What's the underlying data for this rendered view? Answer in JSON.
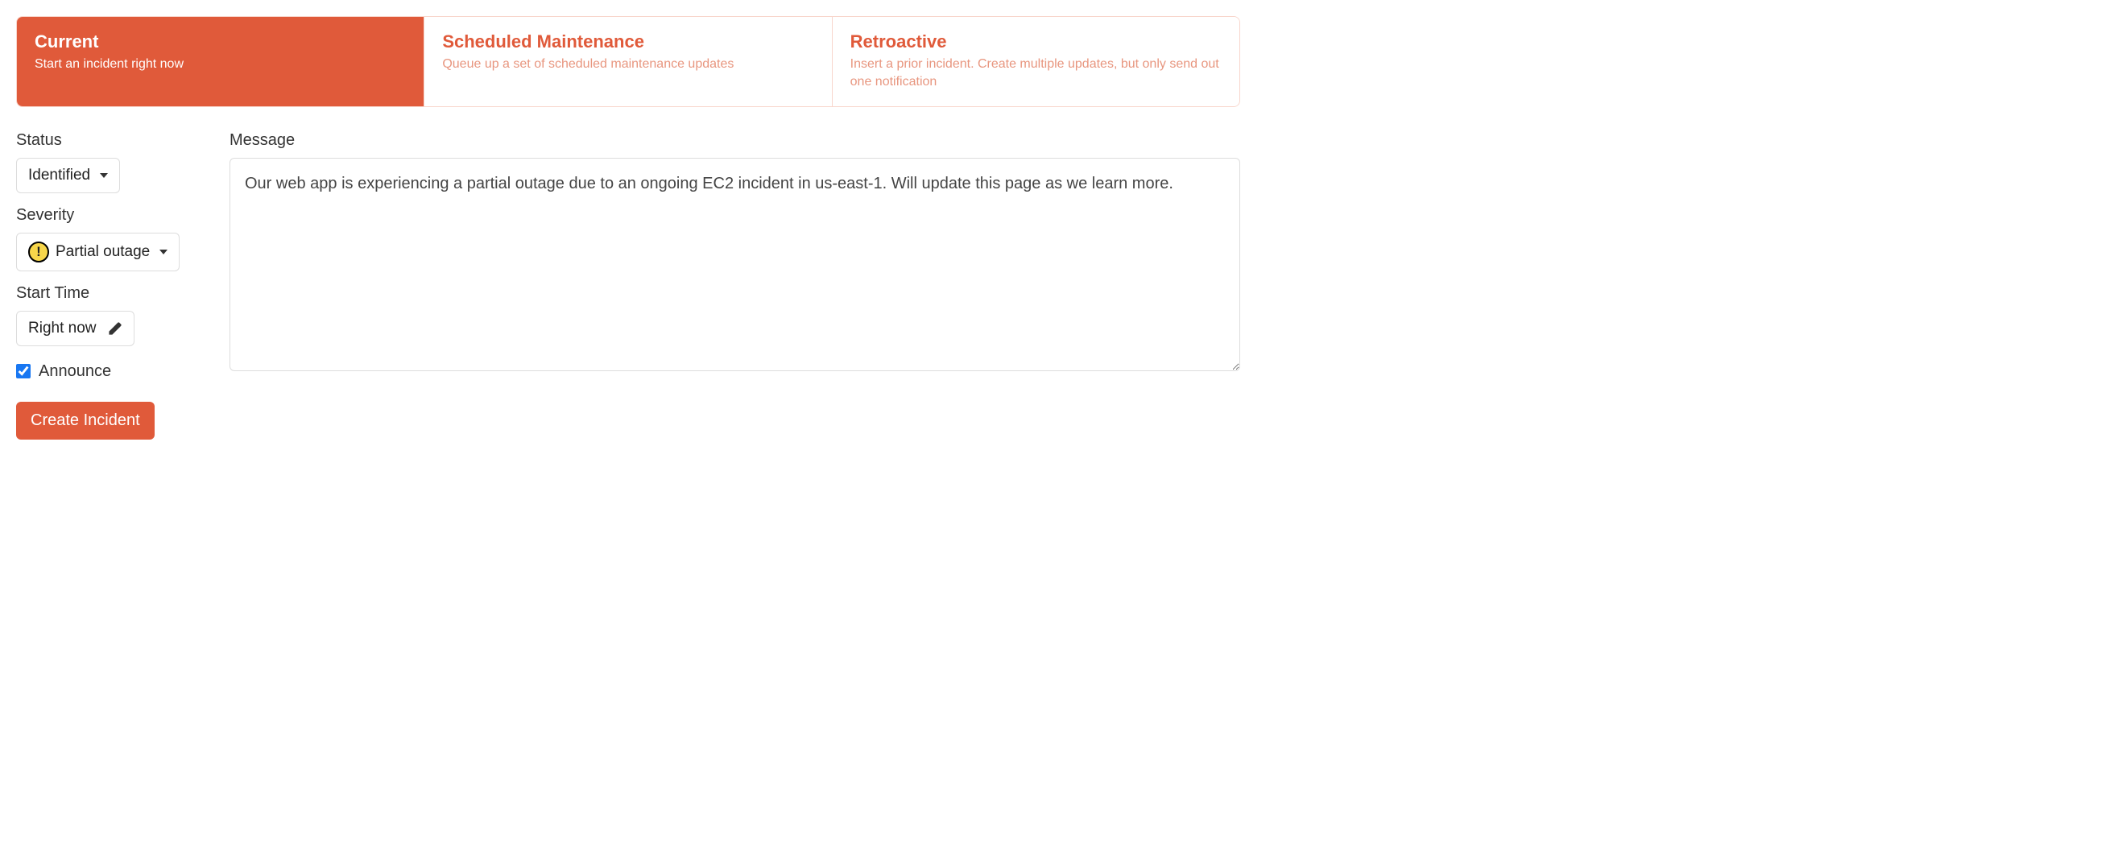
{
  "tabs": [
    {
      "title": "Current",
      "desc": "Start an incident right now"
    },
    {
      "title": "Scheduled Maintenance",
      "desc": "Queue up a set of scheduled maintenance updates"
    },
    {
      "title": "Retroactive",
      "desc": "Insert a prior incident. Create multiple updates, but only send out one notification"
    }
  ],
  "fields": {
    "status": {
      "label": "Status",
      "value": "Identified"
    },
    "severity": {
      "label": "Severity",
      "value": "Partial outage",
      "icon_glyph": "!"
    },
    "start_time": {
      "label": "Start Time",
      "value": "Right now"
    },
    "message": {
      "label": "Message",
      "value": "Our web app is experiencing a partial outage due to an ongoing EC2 incident in us-east-1. Will update this page as we learn more."
    },
    "announce": {
      "label": "Announce",
      "checked": true
    }
  },
  "buttons": {
    "create": "Create Incident"
  }
}
